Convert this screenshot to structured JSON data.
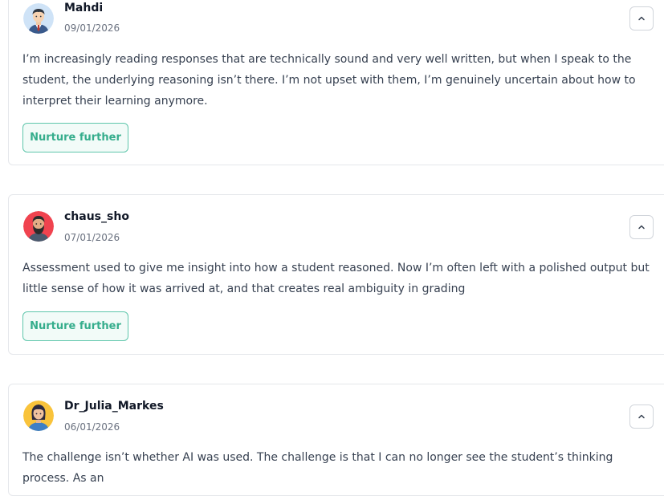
{
  "posts": [
    {
      "author": "Mahdi",
      "date": "09/01/2026",
      "avatar_icon": "avatar-man-suit-icon",
      "text": "I’m increasingly reading responses that are technically sound and very well written, but when I speak to the student, the underlying reasoning isn’t there. I’m not upset with them, I’m genuinely uncertain about how to interpret their learning anymore.",
      "action_label": "Nurture further"
    },
    {
      "author": "chaus_sho",
      "date": "07/01/2026",
      "avatar_icon": "avatar-bearded-man-icon",
      "text": "Assessment used to give me insight into how a student reasoned. Now I’m often left with a polished output but little sense of how it was arrived at, and that creates real ambiguity in grading",
      "action_label": "Nurture further"
    },
    {
      "author": "Dr_Julia_Markes",
      "date": "06/01/2026",
      "avatar_icon": "avatar-woman-icon",
      "text": "The challenge isn’t whether AI was used. The challenge is that I can no longer see the student’s thinking process. As an"
    }
  ],
  "colors": {
    "accent": "#35ad8c",
    "accent_border": "#5fc6ab",
    "card_border": "#e5e7eb"
  }
}
